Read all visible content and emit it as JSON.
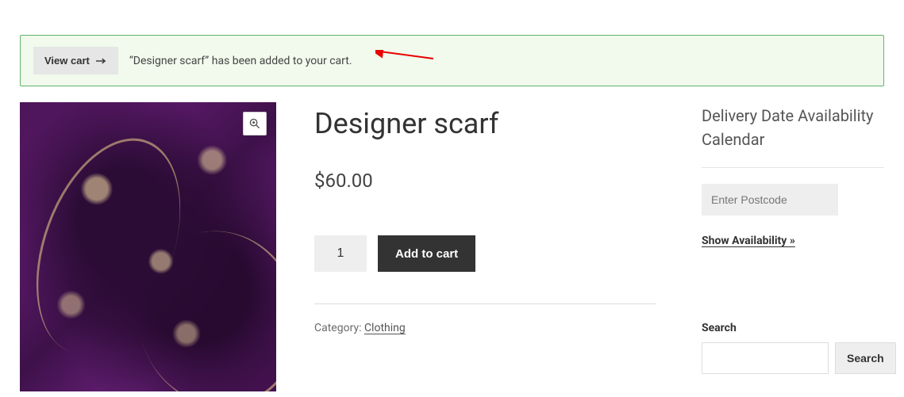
{
  "notice": {
    "view_cart_label": "View cart",
    "message": "“Designer scarf” has been added to your cart."
  },
  "product": {
    "title": "Designer scarf",
    "price": "$60.00",
    "quantity": "1",
    "add_to_cart_label": "Add to cart",
    "category_label": "Category: ",
    "category_link": "Clothing"
  },
  "sidebar": {
    "calendar_heading": "Delivery Date Availability Calendar",
    "postcode_placeholder": "Enter Postcode",
    "show_availability_label": "Show Availability »",
    "search_label": "Search",
    "search_button_label": "Search"
  }
}
